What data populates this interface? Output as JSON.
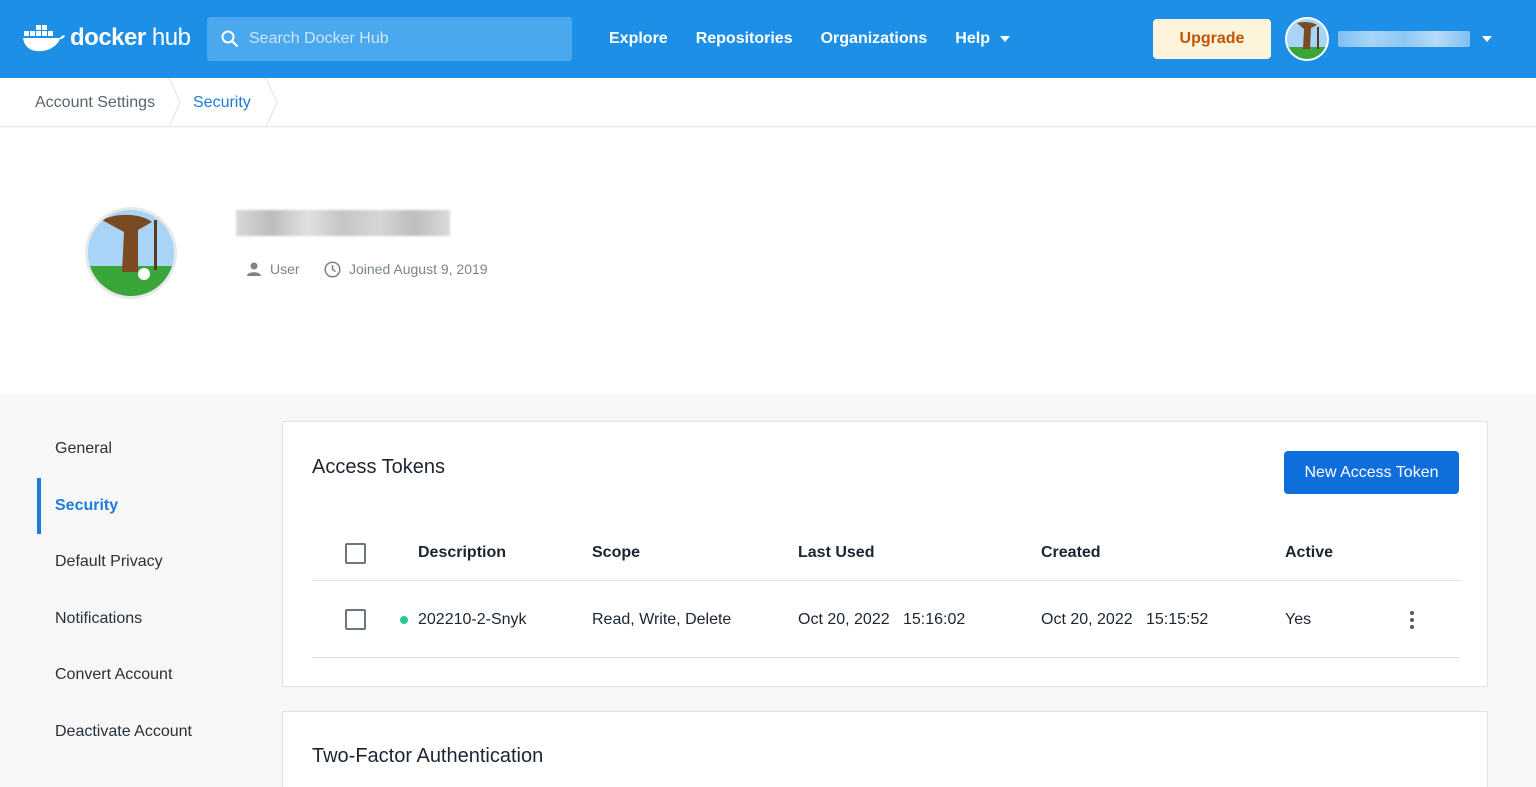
{
  "header": {
    "logo_text_1": "docker",
    "logo_text_2": "hub",
    "search_placeholder": "Search Docker Hub",
    "nav": [
      "Explore",
      "Repositories",
      "Organizations",
      "Help"
    ],
    "upgrade_label": "Upgrade",
    "brand_color": "#1d8fe6"
  },
  "breadcrumb": [
    "Account Settings",
    "Security"
  ],
  "profile": {
    "role": "User",
    "joined": "Joined August 9, 2019"
  },
  "sidebar": {
    "items": [
      {
        "label": "General",
        "active": false
      },
      {
        "label": "Security",
        "active": true
      },
      {
        "label": "Default Privacy",
        "active": false
      },
      {
        "label": "Notifications",
        "active": false
      },
      {
        "label": "Convert Account",
        "active": false
      },
      {
        "label": "Deactivate Account",
        "active": false
      }
    ]
  },
  "tokens": {
    "title": "Access Tokens",
    "new_button": "New Access Token",
    "columns": [
      "Description",
      "Scope",
      "Last Used",
      "Created",
      "Active"
    ],
    "rows": [
      {
        "description": "202210-2-Snyk",
        "scope": "Read, Write, Delete",
        "last_used": "Oct 20, 2022   15:16:02",
        "created": "Oct 20, 2022   15:15:52",
        "active": "Yes"
      }
    ]
  },
  "two_factor": {
    "title": "Two-Factor Authentication"
  }
}
